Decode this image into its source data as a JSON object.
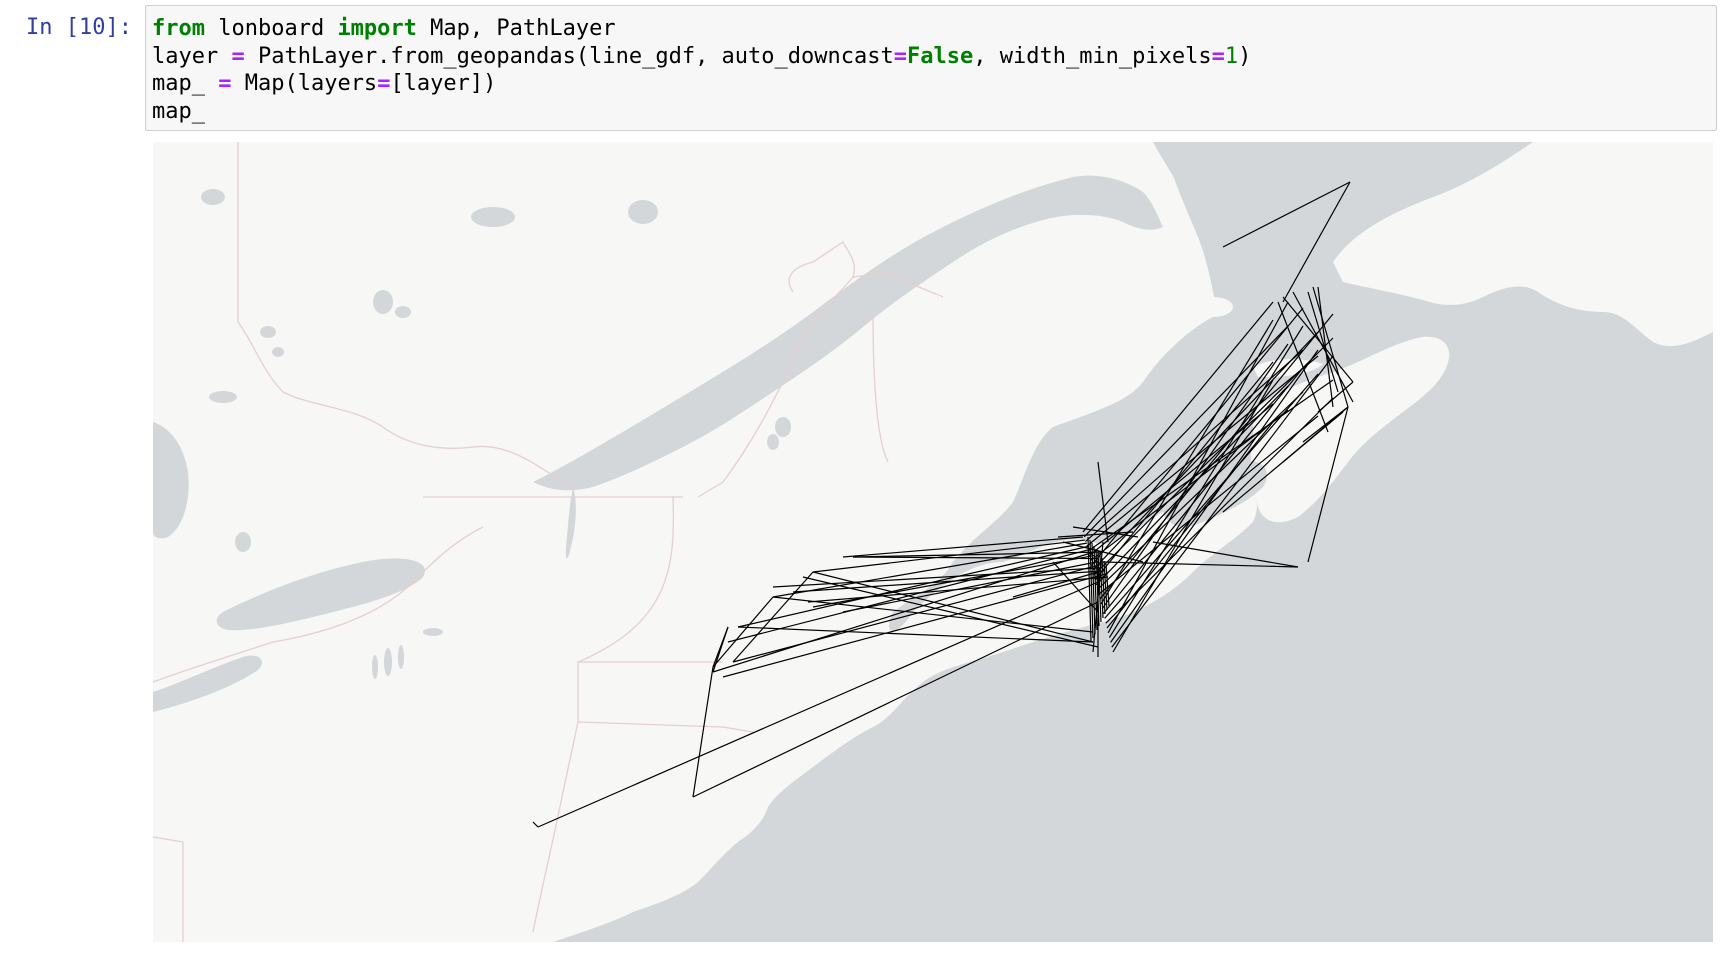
{
  "cell": {
    "prompt": "In [10]:",
    "code_lines": [
      [
        {
          "t": "from",
          "c": "kw"
        },
        {
          "t": " lonboard ",
          "c": ""
        },
        {
          "t": "import",
          "c": "kw"
        },
        {
          "t": " Map, PathLayer",
          "c": ""
        }
      ],
      [
        {
          "t": "layer ",
          "c": ""
        },
        {
          "t": "=",
          "c": "op"
        },
        {
          "t": " PathLayer.from_geopandas(line_gdf, auto_downcast",
          "c": ""
        },
        {
          "t": "=",
          "c": "op"
        },
        {
          "t": "False",
          "c": "bool"
        },
        {
          "t": ", width_min_pixels",
          "c": ""
        },
        {
          "t": "=",
          "c": "op"
        },
        {
          "t": "1",
          "c": "num"
        },
        {
          "t": ")",
          "c": ""
        }
      ],
      [
        {
          "t": "map_ ",
          "c": ""
        },
        {
          "t": "=",
          "c": "op"
        },
        {
          "t": " Map(layers",
          "c": ""
        },
        {
          "t": "=",
          "c": "op"
        },
        {
          "t": "[layer])",
          "c": ""
        }
      ],
      [
        {
          "t": "map_",
          "c": ""
        }
      ]
    ]
  },
  "map": {
    "basemap_colors": {
      "land": "#f7f7f5",
      "water": "#d4d7da",
      "border": "#e6cfd0",
      "paths": "#000000"
    },
    "layer_type": "PathLayer"
  }
}
